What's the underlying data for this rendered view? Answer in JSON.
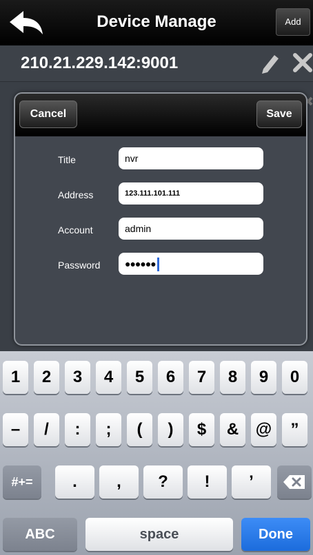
{
  "header": {
    "title": "Device Manage",
    "add_label": "Add"
  },
  "device": {
    "address": "210.21.229.142:9001"
  },
  "dialog": {
    "cancel_label": "Cancel",
    "save_label": "Save",
    "fields": [
      {
        "label": "Title",
        "value": "nvr"
      },
      {
        "label": "Address",
        "value": "123.111.101.111"
      },
      {
        "label": "Account",
        "value": "admin"
      },
      {
        "label": "Password",
        "value": "●●●●●●"
      }
    ]
  },
  "keyboard": {
    "row1": [
      "1",
      "2",
      "3",
      "4",
      "5",
      "6",
      "7",
      "8",
      "9",
      "0"
    ],
    "row2": [
      "–",
      "/",
      ":",
      ";",
      "(",
      ")",
      "$",
      "&",
      "@",
      "”"
    ],
    "row3": [
      ".",
      ",",
      "?",
      "!",
      "’"
    ],
    "symbols_label": "#+=",
    "abc_label": "ABC",
    "space_label": "space",
    "done_label": "Done"
  },
  "colors": {
    "done_key": "#1c6cdc",
    "caret": "#2f6ad9"
  }
}
